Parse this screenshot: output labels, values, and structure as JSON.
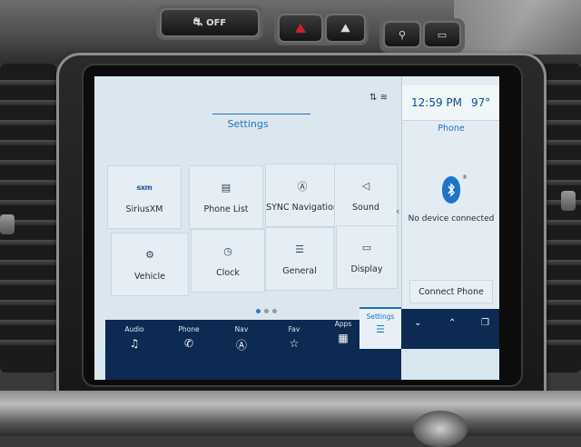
{
  "hardware": {
    "traction_label": "OFF"
  },
  "status_bar": {
    "time": "12:59 PM",
    "temperature": "97°"
  },
  "main": {
    "title": "Settings",
    "tiles": [
      {
        "label": "SiriusXM",
        "icon": "siriusxm-logo",
        "logo_text": "sxm"
      },
      {
        "label": "Phone List",
        "icon": "phone-list-icon"
      },
      {
        "label": "SYNC Navigation",
        "icon": "navigation-icon"
      },
      {
        "label": "Sound",
        "icon": "speaker-icon"
      },
      {
        "label": "Vehicle",
        "icon": "vehicle-icon"
      },
      {
        "label": "Clock",
        "icon": "clock-icon"
      },
      {
        "label": "General",
        "icon": "sliders-icon"
      },
      {
        "label": "Display",
        "icon": "display-icon"
      }
    ],
    "pager": {
      "pages": 3,
      "current": 1
    }
  },
  "side_panel": {
    "title": "Phone",
    "status": "No device connected",
    "connect_button": "Connect Phone"
  },
  "navbar": {
    "items": [
      {
        "label": "Audio",
        "icon": "music-note-icon"
      },
      {
        "label": "Phone",
        "icon": "phone-icon"
      },
      {
        "label": "Nav",
        "icon": "nav-arrow-icon"
      },
      {
        "label": "Fav",
        "icon": "star-icon"
      },
      {
        "label": "Apps",
        "icon": "apps-grid-icon"
      },
      {
        "label": "Settings",
        "icon": "settings-sliders-icon",
        "active": true
      }
    ]
  },
  "colors": {
    "accent": "#1e6fc2",
    "navbar": "#0d2a52",
    "screen_bg": "#dbe7ef"
  }
}
